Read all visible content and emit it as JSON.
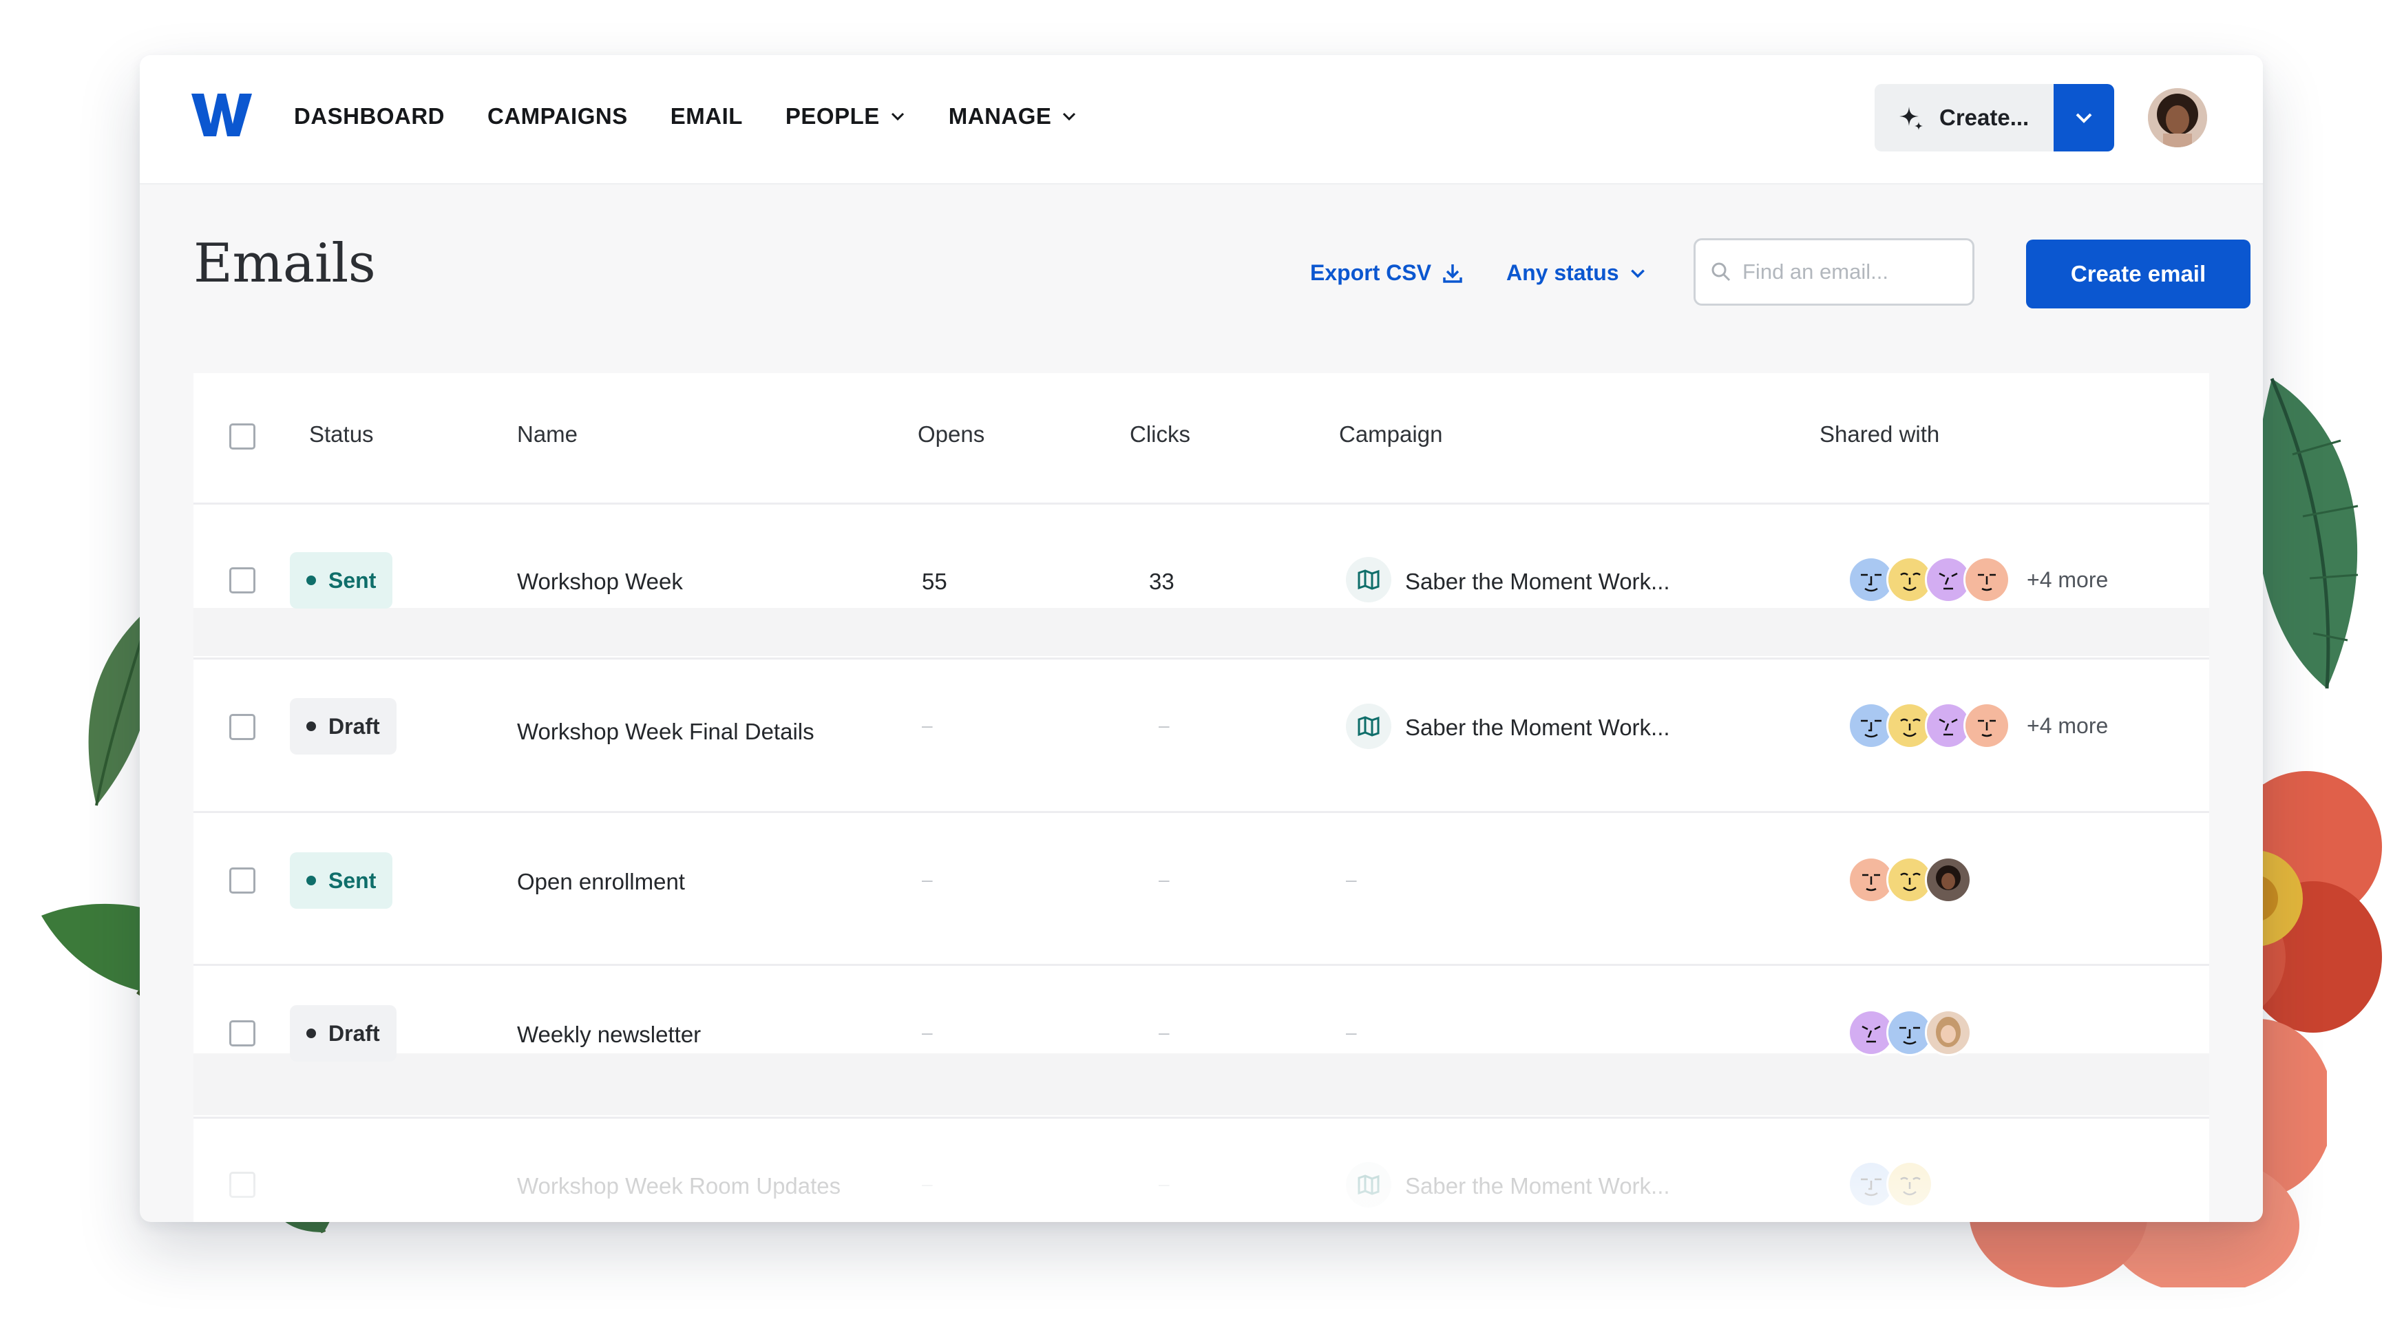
{
  "nav": {
    "logo": "W",
    "items": [
      {
        "label": "DASHBOARD",
        "has_menu": false
      },
      {
        "label": "CAMPAIGNS",
        "has_menu": false
      },
      {
        "label": "EMAIL",
        "has_menu": false
      },
      {
        "label": "PEOPLE",
        "has_menu": true
      },
      {
        "label": "MANAGE",
        "has_menu": true
      }
    ],
    "create_label": "Create..."
  },
  "page": {
    "title": "Emails",
    "export_label": "Export CSV",
    "status_filter_label": "Any status",
    "search_placeholder": "Find an email...",
    "create_email_label": "Create email"
  },
  "table": {
    "columns": [
      "Status",
      "Name",
      "Opens",
      "Clicks",
      "Campaign",
      "Shared with"
    ],
    "rows": [
      {
        "status": "Sent",
        "name": "Workshop Week",
        "opens": "55",
        "clicks": "33",
        "campaign": "Saber the Moment Work...",
        "shared": [
          "blue-face",
          "yellow-face",
          "purple-face",
          "peach-face"
        ],
        "more": "+4 more"
      },
      {
        "status": "Draft",
        "name": "Workshop Week Final Details",
        "opens": "–",
        "clicks": "–",
        "campaign": "Saber the Moment Work...",
        "shared": [
          "blue-face",
          "yellow-face",
          "purple-face",
          "peach-face"
        ],
        "more": "+4 more"
      },
      {
        "status": "Sent",
        "name": "Open enrollment",
        "opens": "–",
        "clicks": "–",
        "campaign": "–",
        "shared": [
          "peach-face",
          "yellow-face",
          "photo-dark"
        ],
        "more": ""
      },
      {
        "status": "Draft",
        "name": "Weekly newsletter",
        "opens": "–",
        "clicks": "–",
        "campaign": "–",
        "shared": [
          "purple-face",
          "blue-face",
          "photo-light"
        ],
        "more": ""
      },
      {
        "status": "",
        "name": "Workshop Week Room Updates",
        "opens": "–",
        "clicks": "–",
        "campaign": "Saber the Moment Work...",
        "shared": [
          "blue-face",
          "yellow-face"
        ],
        "more": ""
      }
    ]
  },
  "colors": {
    "brand_blue": "#0b57d0",
    "sent_green": "#0f6e6a",
    "sent_bg": "#e4f4f2"
  },
  "icons": {
    "logo": "w-logo-icon",
    "sparkle": "sparkle-icon",
    "download": "download-icon",
    "chevron": "chevron-down-icon",
    "search": "search-icon",
    "campaign": "campaign-flag-icon"
  }
}
